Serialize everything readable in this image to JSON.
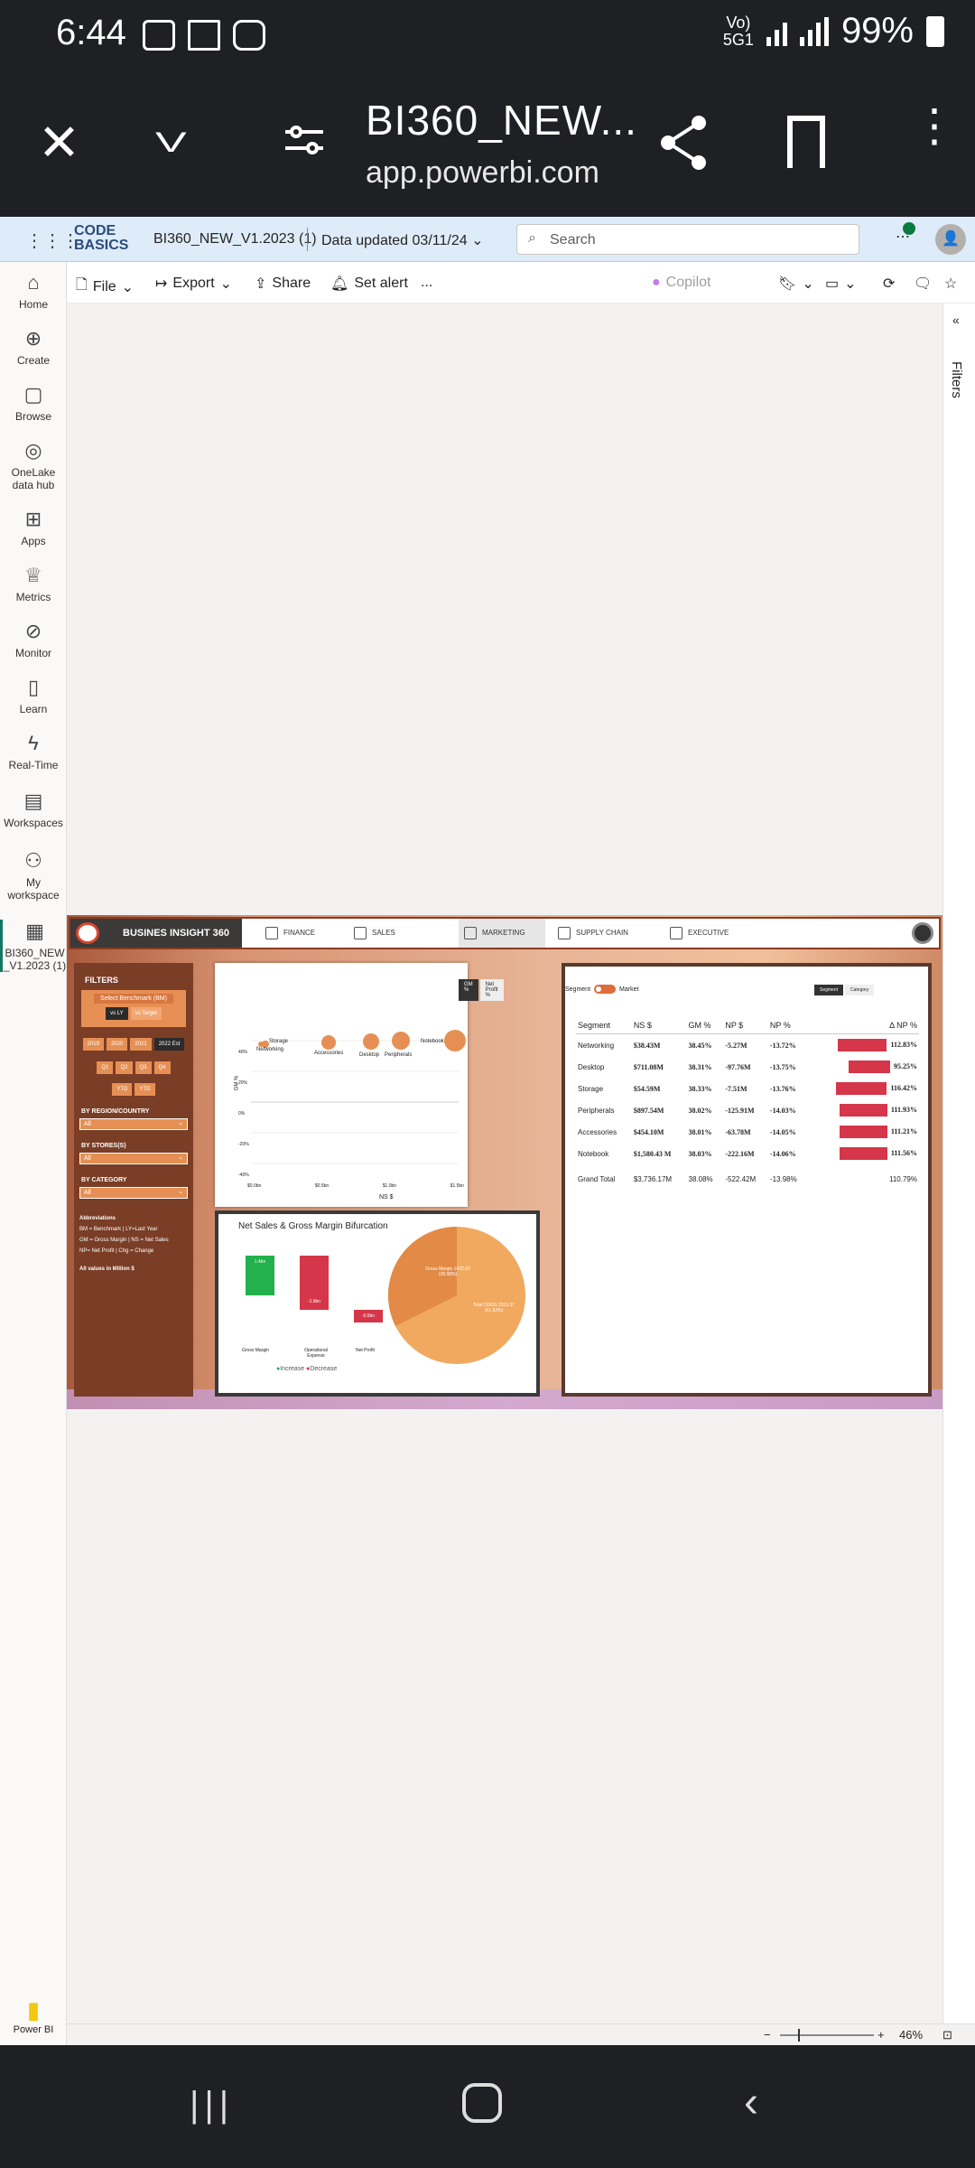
{
  "status_bar": {
    "time": "6:44",
    "network": "Vo) 5G 5G1",
    "battery": "99%"
  },
  "browser": {
    "title": "BI360_NEW...",
    "url": "app.powerbi.com"
  },
  "pbi_header": {
    "logo": "CODE BASICS",
    "report_name": "BI360_NEW_V1.2023 (1)",
    "data_updated": "Data updated 03/11/24",
    "search_placeholder": "Search"
  },
  "toolbar": {
    "file": "File",
    "export": "Export",
    "share": "Share",
    "set_alert": "Set alert",
    "more": "...",
    "copilot": "Copilot"
  },
  "nav": [
    {
      "label": "Home",
      "icon": "home-icon"
    },
    {
      "label": "Create",
      "icon": "plus-icon"
    },
    {
      "label": "Browse",
      "icon": "folder-icon"
    },
    {
      "label": "OneLake data hub",
      "icon": "onelake-icon"
    },
    {
      "label": "Apps",
      "icon": "apps-icon"
    },
    {
      "label": "Metrics",
      "icon": "trophy-icon"
    },
    {
      "label": "Monitor",
      "icon": "monitor-icon"
    },
    {
      "label": "Learn",
      "icon": "book-icon"
    },
    {
      "label": "Real-Time",
      "icon": "lightning-icon"
    },
    {
      "label": "Workspaces",
      "icon": "workspaces-icon"
    },
    {
      "label": "My workspace",
      "icon": "person-icon"
    },
    {
      "label": "BI360_NEW _V1.2023 (1)",
      "icon": "report-icon"
    }
  ],
  "filters_pane": {
    "label": "Filters"
  },
  "report": {
    "brand": "BUSINES INSIGHT 360",
    "tabs": [
      "FINANCE",
      "SALES",
      "MARKETING",
      "SUPPLY CHAIN",
      "EXECUTIVE"
    ],
    "filters": {
      "title": "FILTERS",
      "benchmark_title": "Select Benchmark (BM)",
      "benchmark_options": [
        "vs LY",
        "vs Target"
      ],
      "years": [
        "2019",
        "2020",
        "2021",
        "2022 Est"
      ],
      "quarters": [
        "Q1",
        "Q2",
        "Q3",
        "Q4"
      ],
      "periods": [
        "YTD",
        "YTG"
      ],
      "region_label": "BY REGION/COUNTRY",
      "store_label": "BY STORES(S)",
      "category_label": "BY CATEGORY",
      "dropdown_value": "All",
      "abbr_title": "Abbreviations",
      "abbr_lines": [
        "BM = Benchmark | LY=Last Year",
        "GM = Gross Margin | NS = Net Sales",
        "NP= Net Profit | Chg = Change"
      ],
      "units_note": "All values in Million $"
    },
    "scatter": {
      "toggle": [
        "GM %",
        "Net Profit %"
      ],
      "y_label": "GM %",
      "x_label": "NS $",
      "y_ticks": [
        "40%",
        "20%",
        "0%",
        "-20%",
        "-40%"
      ],
      "x_ticks": [
        "$0.0bn",
        "$0.5bn",
        "$1.0bn",
        "$1.5bn"
      ],
      "points": [
        "Storage",
        "Networking",
        "Accessories",
        "Desktop",
        "Peripherals",
        "Notebook"
      ]
    },
    "waterfall": {
      "title": "Net Sales & Gross Margin Bifurcation",
      "bars": [
        {
          "label": "Gross Margin",
          "value": "1.4bn"
        },
        {
          "label": "Operational Expense",
          "value": "-1.9bn"
        },
        {
          "label": "Net Profit",
          "value": "-0.5bn"
        }
      ],
      "legend": [
        "Increase",
        "Decrease"
      ],
      "pie": [
        {
          "label": "Gross Margin 1422.80 (38.08%)"
        },
        {
          "label": "Total COGS 2313.37 (61.92%)"
        }
      ]
    },
    "table": {
      "toggle_labels": [
        "Segment",
        "Market"
      ],
      "switch": [
        "Segment",
        "Category"
      ],
      "headers": [
        "Segment",
        "NS $",
        "GM %",
        "NP $",
        "NP %",
        "Δ NP %"
      ],
      "rows": [
        {
          "seg": "Networking",
          "ns": "$38.43M",
          "gm": "38.45%",
          "np": "-5.27M",
          "npp": "-13.72%",
          "d": "112.83%",
          "bar": 0.9
        },
        {
          "seg": "Desktop",
          "ns": "$711.08M",
          "gm": "38.31%",
          "np": "-97.76M",
          "npp": "-13.75%",
          "d": "95.25%",
          "bar": 0.76
        },
        {
          "seg": "Storage",
          "ns": "$54.59M",
          "gm": "38.33%",
          "np": "-7.51M",
          "npp": "-13.76%",
          "d": "116.42%",
          "bar": 0.93
        },
        {
          "seg": "Peripherals",
          "ns": "$897.54M",
          "gm": "38.02%",
          "np": "-125.91M",
          "npp": "-14.03%",
          "d": "111.93%",
          "bar": 0.89
        },
        {
          "seg": "Accessories",
          "ns": "$454.10M",
          "gm": "38.01%",
          "np": "-63.78M",
          "npp": "-14.05%",
          "d": "111.21%",
          "bar": 0.89
        },
        {
          "seg": "Notebook",
          "ns": "$1,580.43 M",
          "gm": "38.03%",
          "np": "-222.16M",
          "npp": "-14.06%",
          "d": "111.56%",
          "bar": 0.89
        }
      ],
      "total": {
        "seg": "Grand Total",
        "ns": "$3,736.17M",
        "gm": "38.08%",
        "np": "-522.42M",
        "npp": "-13.98%",
        "d": "110.79%"
      }
    }
  },
  "zoom": {
    "value": "46%"
  },
  "pbi_brand": "Power BI",
  "colors": {
    "accent": "#e68f54",
    "dark": "#7a3d26",
    "negative": "#d63649",
    "positive": "#22b14c"
  }
}
